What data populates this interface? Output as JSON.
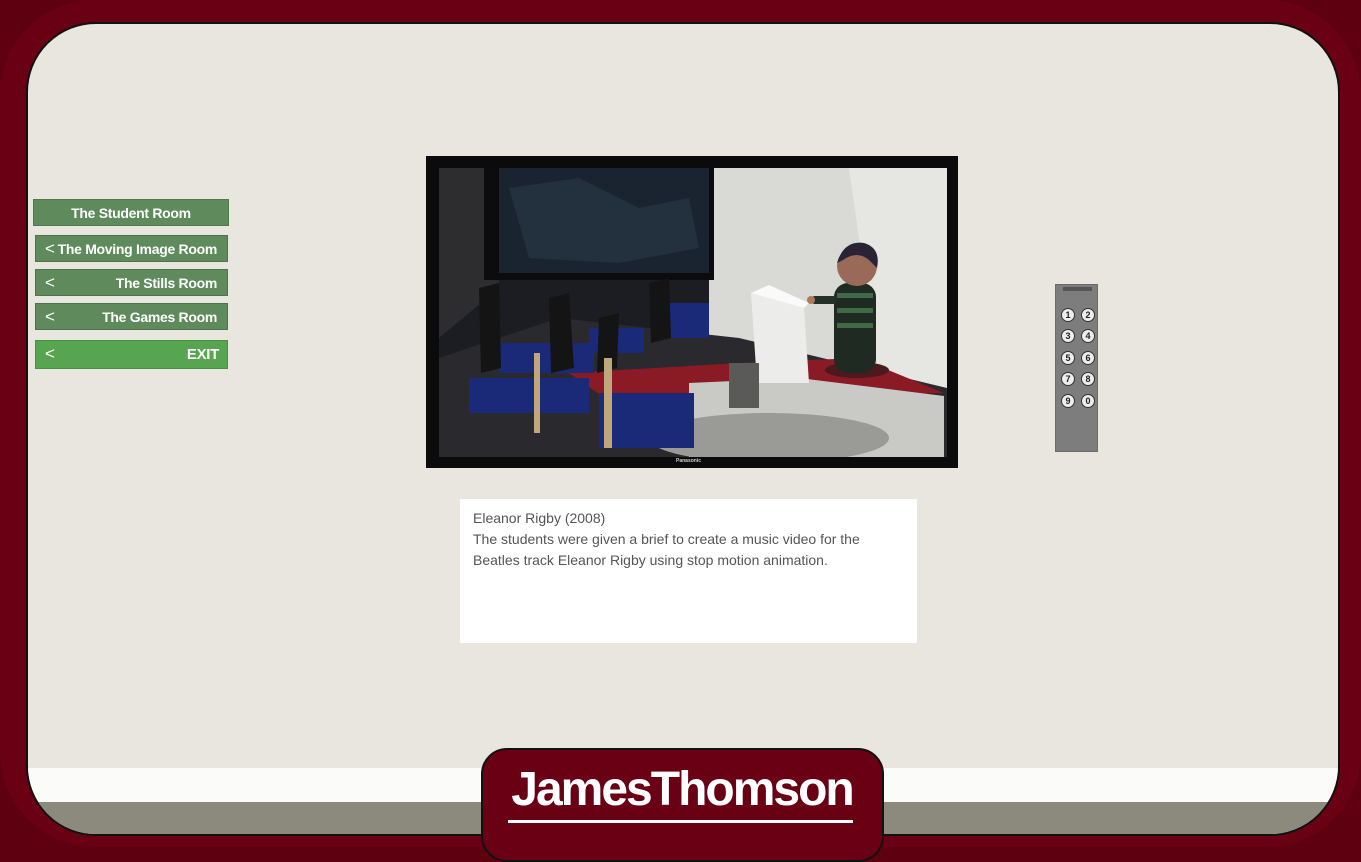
{
  "nav": {
    "title": "The Student Room",
    "items": [
      {
        "chevron": "<",
        "label": "The Moving Image Room"
      },
      {
        "chevron": "<",
        "label": "The Stills Room"
      },
      {
        "chevron": "<",
        "label": "The Games Room"
      }
    ],
    "exit": {
      "chevron": "<",
      "label": "EXIT"
    }
  },
  "tv": {
    "brand": "Panasonic"
  },
  "caption": {
    "title": "Eleanor Rigby (2008)",
    "line1": "The students were given a brief to create a music video for the",
    "line2": "Beatles track Eleanor Rigby using stop motion animation."
  },
  "remote": {
    "keys": [
      "1",
      "2",
      "3",
      "4",
      "5",
      "6",
      "7",
      "8",
      "9",
      "0"
    ]
  },
  "logo": {
    "text": "JamesThomson"
  },
  "colors": {
    "frame": "#6a0013",
    "nav": "#5e8a5c",
    "exit": "#58a551",
    "wall": "#e8e6de"
  }
}
